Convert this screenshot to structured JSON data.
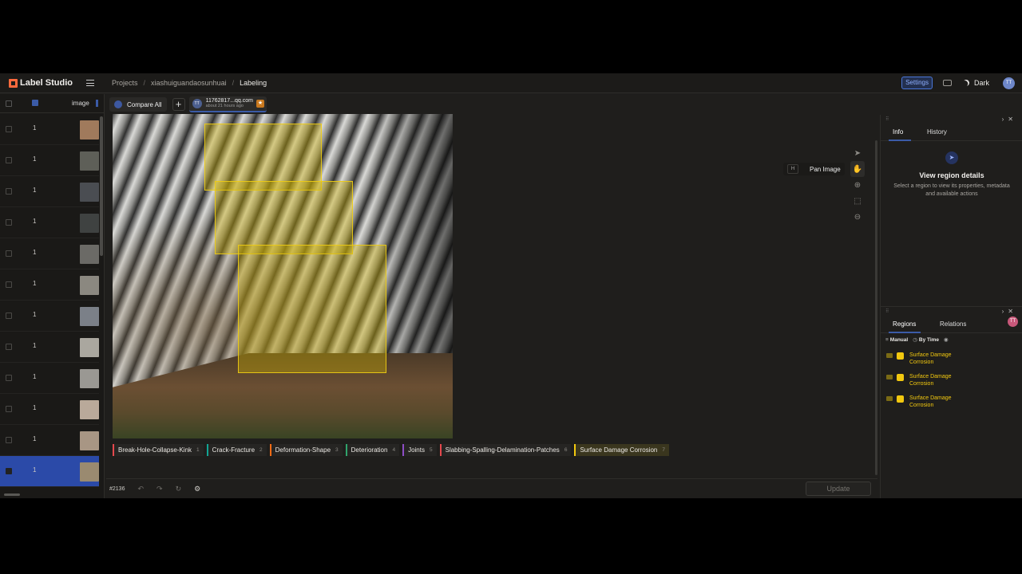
{
  "app": {
    "name": "Label Studio"
  },
  "breadcrumb": {
    "projects": "Projects",
    "project": "xiashuiguandaosunhuai",
    "current": "Labeling"
  },
  "header": {
    "settings_label": "Settings",
    "theme_label": "Dark",
    "avatar_initials": "TT"
  },
  "datalist": {
    "column_image": "image",
    "rows": [
      {
        "num": "1",
        "thumb": "#a07a5c"
      },
      {
        "num": "1",
        "thumb": "#5e5f58"
      },
      {
        "num": "1",
        "thumb": "#4a4d52"
      },
      {
        "num": "1",
        "thumb": "#3f4241"
      },
      {
        "num": "1",
        "thumb": "#6b6a66"
      },
      {
        "num": "1",
        "thumb": "#8b8880"
      },
      {
        "num": "1",
        "thumb": "#7b8088"
      },
      {
        "num": "1",
        "thumb": "#aaa79f"
      },
      {
        "num": "1",
        "thumb": "#9a9893"
      },
      {
        "num": "1",
        "thumb": "#b9a99a"
      },
      {
        "num": "1",
        "thumb": "#a89684"
      },
      {
        "num": "1",
        "thumb": "#9a8a70",
        "selected": true
      }
    ]
  },
  "tabs": {
    "compare_all": "Compare All",
    "annotation_name": "11762817...qq.com",
    "annotation_time": "about 21 hours ago"
  },
  "labels": [
    {
      "name": "Break-Hole-Collapse-Kink",
      "key": "1",
      "color": "#e5484d"
    },
    {
      "name": "Crack-Fracture",
      "key": "2",
      "color": "#12a594"
    },
    {
      "name": "Deformation-Shape",
      "key": "3",
      "color": "#f76b15"
    },
    {
      "name": "Deterioration",
      "key": "4",
      "color": "#30a46c"
    },
    {
      "name": "Joints",
      "key": "5",
      "color": "#8e4ec6"
    },
    {
      "name": "Slabbing-Spalling-Delamination-Patches",
      "key": "6",
      "color": "#e5484d"
    },
    {
      "name": "Surface Damage Corrosion",
      "key": "7",
      "color": "#f2c80f"
    }
  ],
  "bottombar": {
    "task_id": "#2136",
    "update_label": "Update"
  },
  "toolbar": {
    "hotkey": "H",
    "active_tool_label": "Pan Image"
  },
  "info_panel": {
    "tab_info": "Info",
    "tab_history": "History",
    "title": "View region details",
    "description": "Select a region to view its properties, metadata and available actions"
  },
  "regions_panel": {
    "tab_regions": "Regions",
    "tab_relations": "Relations",
    "filter_manual": "Manual",
    "filter_by_time": "By Time",
    "regions": [
      {
        "label_line1": "Surface Damage",
        "label_line2": "Corrosion"
      },
      {
        "label_line1": "Surface Damage",
        "label_line2": "Corrosion"
      },
      {
        "label_line1": "Surface Damage",
        "label_line2": "Corrosion"
      }
    ]
  },
  "icons": [
    "hamburger-icon",
    "keyboard-icon",
    "moon-icon",
    "grid-icon",
    "plus-icon",
    "star-icon",
    "undo-icon",
    "redo-icon",
    "reset-icon",
    "settings-sliders-icon",
    "pointer-icon",
    "hand-icon",
    "zoom-in-icon",
    "fit-icon",
    "zoom-out-icon",
    "cursor-icon",
    "eye-icon"
  ]
}
